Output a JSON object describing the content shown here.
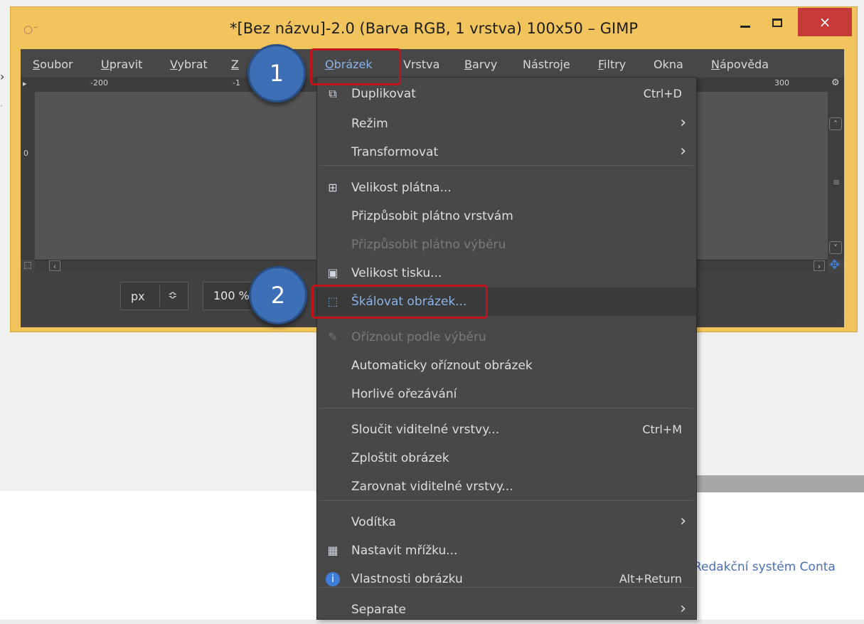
{
  "window": {
    "title": "*[Bez názvu]-2.0 (Barva RGB, 1 vrstva) 100x50 – GIMP",
    "close_glyph": "×"
  },
  "menubar": [
    "Soubor",
    "Upravit",
    "Vybrat",
    "Z",
    "Obrázek",
    "Vrstva",
    "Barvy",
    "Nástroje",
    "Filtry",
    "Okna",
    "Nápověda"
  ],
  "ruler": {
    "top_labels": [
      "-200",
      "-1",
      "300"
    ],
    "left_label": "0"
  },
  "statusbar": {
    "unit": "px",
    "zoom": "100 %"
  },
  "callouts": {
    "one": "1",
    "two": "2"
  },
  "image_menu": [
    {
      "label": "Duplikovat",
      "shortcut": "Ctrl+D",
      "icon": "duplicate-icon"
    },
    {
      "label": "Režim",
      "submenu": true
    },
    {
      "label": "Transformovat",
      "submenu": true
    },
    {
      "label": "Velikost plátna...",
      "icon": "canvas-size-icon"
    },
    {
      "label": "Přizpůsobit plátno vrstvám"
    },
    {
      "label": "Přizpůsobit plátno výběru",
      "disabled": true
    },
    {
      "label": "Velikost tisku...",
      "icon": "print-size-icon"
    },
    {
      "label": "Škálovat obrázek...",
      "icon": "scale-image-icon",
      "active": true
    },
    {
      "label": "Oříznout podle výběru",
      "icon": "crop-icon",
      "disabled": true
    },
    {
      "label": "Automaticky oříznout obrázek"
    },
    {
      "label": "Horlivé ořezávání"
    },
    {
      "label": "Sloučit viditelné vrstvy...",
      "shortcut": "Ctrl+M"
    },
    {
      "label": "Zploštit obrázek"
    },
    {
      "label": "Zarovnat viditelné vrstvy..."
    },
    {
      "label": "Vodítka",
      "submenu": true
    },
    {
      "label": "Nastavit mřížku...",
      "icon": "grid-icon"
    },
    {
      "label": "Vlastnosti obrázku",
      "shortcut": "Alt+Return",
      "icon": "info-icon"
    },
    {
      "label": "Separate",
      "submenu": true
    }
  ],
  "background": {
    "link_text": "Redakční systém Conta"
  },
  "colors": {
    "window_frame": "#f2c45d",
    "highlight": "#c0141a",
    "callout": "#3c6fb5",
    "menu_bg": "#484848"
  }
}
